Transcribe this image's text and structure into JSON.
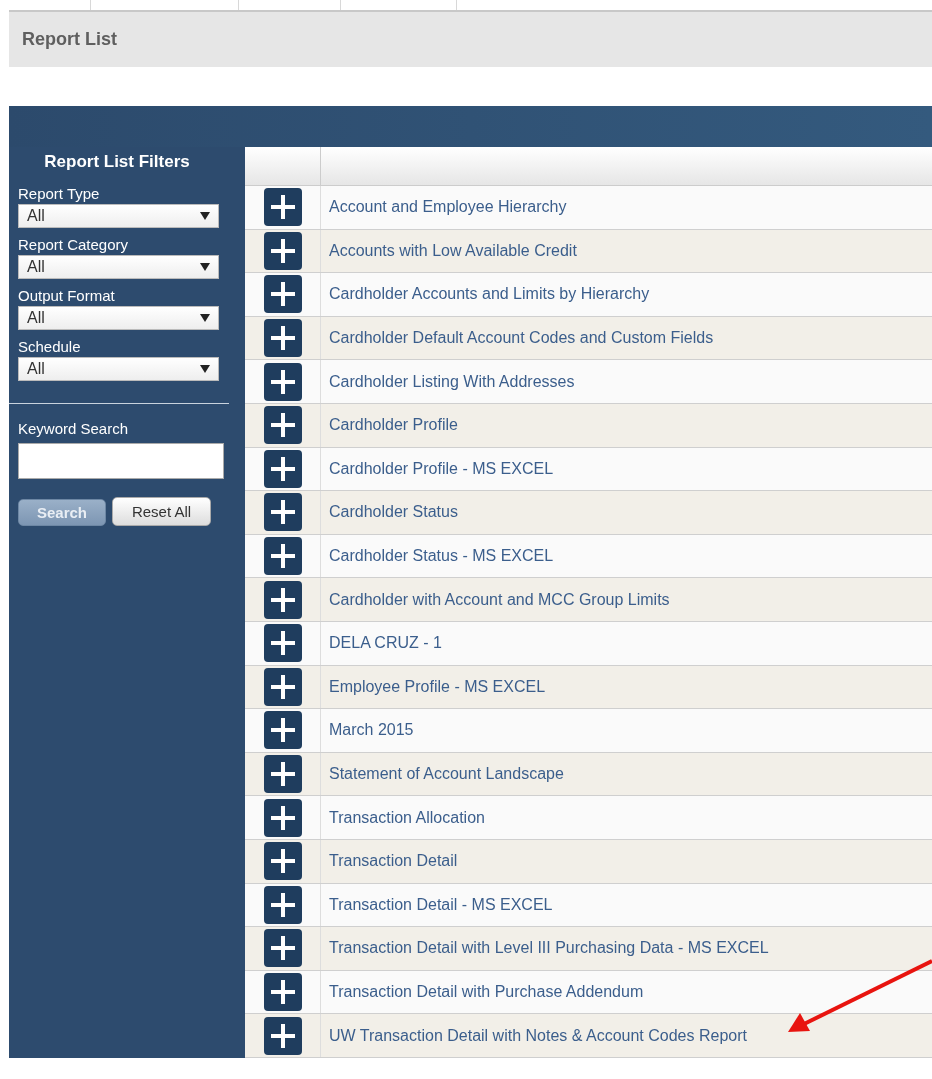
{
  "page_title": "Report List",
  "filters": {
    "title": "Report List Filters",
    "selects": [
      {
        "label": "Report Type",
        "value": "All"
      },
      {
        "label": "Report Category",
        "value": "All"
      },
      {
        "label": "Output Format",
        "value": "All"
      },
      {
        "label": "Schedule",
        "value": "All"
      }
    ],
    "keyword_label": "Keyword Search",
    "search_button": "Search",
    "reset_button": "Reset All"
  },
  "reports": [
    "Account and Employee Hierarchy",
    "Accounts with Low Available Credit",
    "Cardholder Accounts and Limits by Hierarchy",
    "Cardholder Default Account Codes and Custom Fields",
    "Cardholder Listing With Addresses",
    "Cardholder Profile",
    "Cardholder Profile - MS EXCEL",
    "Cardholder Status",
    "Cardholder Status - MS EXCEL",
    "Cardholder with Account and MCC Group Limits",
    "DELA CRUZ - 1",
    "Employee Profile - MS EXCEL",
    "March 2015",
    "Statement of Account Landscape",
    "Transaction Allocation",
    "Transaction Detail",
    "Transaction Detail - MS EXCEL",
    "Transaction Detail with Level III Purchasing Data - MS EXCEL",
    "Transaction Detail with Purchase Addendum",
    "UW Transaction Detail with Notes & Account Codes Report"
  ]
}
